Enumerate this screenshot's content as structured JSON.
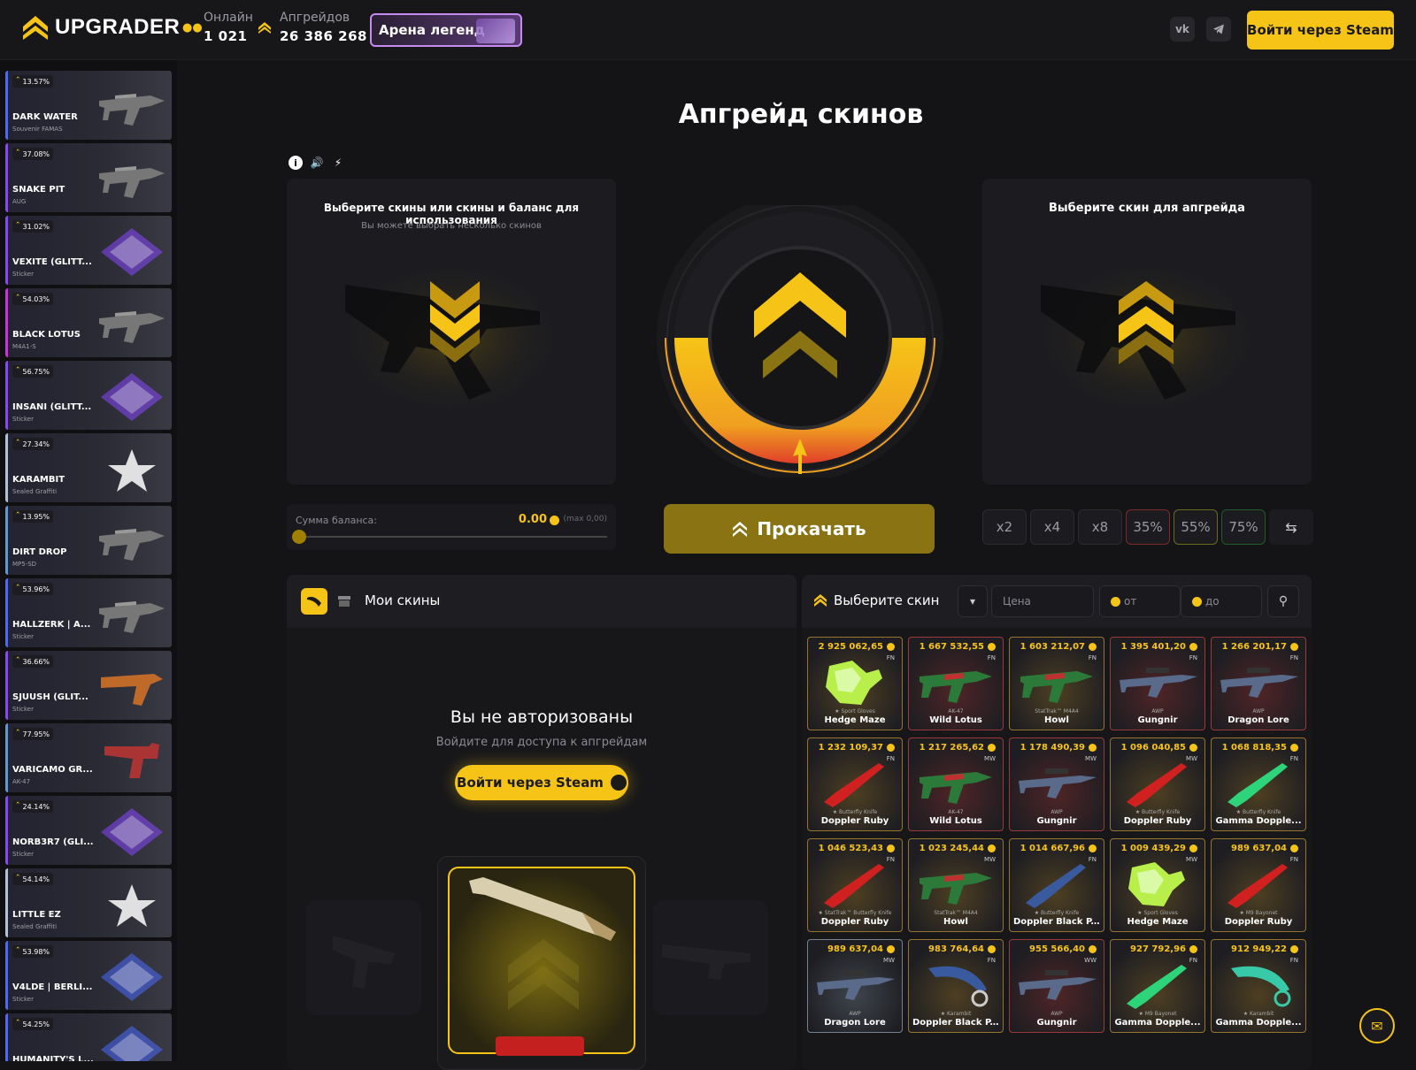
{
  "header": {
    "logo_text": "UPGRADER",
    "online_label": "Онлайн",
    "online_value": "1 021",
    "upgrades_label": "Апгрейдов",
    "upgrades_value": "26 386 268",
    "arena_label": "Арена легенд",
    "social": [
      "vk-icon",
      "telegram-icon"
    ],
    "login_label": "Войти через Steam"
  },
  "sidebar": {
    "items": [
      {
        "chance": "13.57%",
        "name": "DARK WATER",
        "sub": "Souvenir FAMAS",
        "accent": "#4b69ff",
        "img": "rifle"
      },
      {
        "chance": "37.08%",
        "name": "SNAKE PIT",
        "sub": "AUG",
        "accent": "#8847ff",
        "img": "rifle"
      },
      {
        "chance": "31.02%",
        "name": "VEXITE (GLITT...",
        "sub": "Sticker",
        "accent": "#8847ff",
        "img": "sticker"
      },
      {
        "chance": "54.03%",
        "name": "BLACK LOTUS",
        "sub": "M4A1-S",
        "accent": "#d32ce6",
        "img": "rifle"
      },
      {
        "chance": "56.75%",
        "name": "INSANI (GLITT...",
        "sub": "Sticker",
        "accent": "#8847ff",
        "img": "sticker"
      },
      {
        "chance": "27.34%",
        "name": "KARAMBIT",
        "sub": "Sealed Graffiti",
        "accent": "#b0c3d9",
        "img": "graffiti"
      },
      {
        "chance": "13.95%",
        "name": "DIRT DROP",
        "sub": "MP5-SD",
        "accent": "#5e98d9",
        "img": "rifle"
      },
      {
        "chance": "53.96%",
        "name": "HALLZERK | A...",
        "sub": "Sticker",
        "accent": "#4b69ff",
        "img": "rifle"
      },
      {
        "chance": "36.66%",
        "name": "SJUUSH (GLIT...",
        "sub": "Sticker",
        "accent": "#8847ff",
        "img": "smg"
      },
      {
        "chance": "77.95%",
        "name": "VARICAMO GR...",
        "sub": "AK-47",
        "accent": "#5e98d9",
        "img": "revolver"
      },
      {
        "chance": "24.14%",
        "name": "NORB3R7 (GLI...",
        "sub": "Sticker",
        "accent": "#8847ff",
        "img": "sticker"
      },
      {
        "chance": "54.14%",
        "name": "LITTLE EZ",
        "sub": "Sealed Graffiti",
        "accent": "#b0c3d9",
        "img": "graffiti"
      },
      {
        "chance": "53.98%",
        "name": "V4LDE | BERLI...",
        "sub": "Sticker",
        "accent": "#4b69ff",
        "img": "sticker"
      },
      {
        "chance": "54.25%",
        "name": "HUMANITY'S L...",
        "sub": "",
        "accent": "#4b69ff",
        "img": "sticker"
      }
    ]
  },
  "main": {
    "title": "Апгрейд скинов",
    "left_panel_title": "Выберите скины или скины и баланс для использования",
    "left_panel_sub": "Вы можете выбрать несколько скинов",
    "right_panel_title": "Выберите скин для апгрейда",
    "balance_label": "Сумма баланса:",
    "balance_value": "0.00",
    "balance_max": "(max 0,00)",
    "balance_fraction": 0,
    "upgrade_label": "Прокачать",
    "multipliers": [
      "x2",
      "x4",
      "x8",
      "35%",
      "55%",
      "75%"
    ],
    "mult_colors": [
      "#2a2a30",
      "#2a2a30",
      "#2a2a30",
      "#7a2a2a",
      "#6a6a1a",
      "#1f5a2a"
    ]
  },
  "my_skins": {
    "title": "Мои скины",
    "noauth_title": "Вы не авторизованы",
    "noauth_sub": "Войдите для доступа к апгрейдам",
    "login_label": "Войти через Steam"
  },
  "choose": {
    "title": "Выберите скин",
    "price_placeholder": "Цена",
    "from_placeholder": "от",
    "to_placeholder": "до",
    "cards": [
      {
        "price": "2 925 062,65",
        "q": "FN",
        "w": "★ Sport Gloves",
        "n": "Hedge Maze",
        "color": "#e4ae39",
        "img": "gloves"
      },
      {
        "price": "1 667 532,55",
        "q": "FN",
        "w": "AK-47",
        "n": "Wild Lotus",
        "color": "#eb4b4b",
        "img": "ak"
      },
      {
        "price": "1 603 212,07",
        "q": "FN",
        "w": "StatTrak™ M4A4",
        "n": "Howl",
        "color": "#e4ae39",
        "img": "ak"
      },
      {
        "price": "1 395 401,20",
        "q": "FN",
        "w": "AWP",
        "n": "Gungnir",
        "color": "#eb4b4b",
        "img": "awp"
      },
      {
        "price": "1 266 201,17",
        "q": "FN",
        "w": "AWP",
        "n": "Dragon Lore",
        "color": "#eb4b4b",
        "img": "awp"
      },
      {
        "price": "1 232 109,37",
        "q": "FN",
        "w": "★ Butterfly Knife",
        "n": "Doppler Ruby",
        "color": "#e4ae39",
        "img": "knife"
      },
      {
        "price": "1 217 265,62",
        "q": "MW",
        "w": "AK-47",
        "n": "Wild Lotus",
        "color": "#eb4b4b",
        "img": "ak"
      },
      {
        "price": "1 178 490,39",
        "q": "MW",
        "w": "AWP",
        "n": "Gungnir",
        "color": "#eb4b4b",
        "img": "awp"
      },
      {
        "price": "1 096 040,85",
        "q": "MW",
        "w": "★ Butterfly Knife",
        "n": "Doppler Ruby",
        "color": "#e4ae39",
        "img": "knife"
      },
      {
        "price": "1 068 818,35",
        "q": "FN",
        "w": "★ Butterfly Knife",
        "n": "Gamma Dopple...",
        "color": "#e4ae39",
        "img": "knife2"
      },
      {
        "price": "1 046 523,43",
        "q": "FN",
        "w": "★ StatTrak™ Butterfly Knife",
        "n": "Doppler Ruby",
        "color": "#e4ae39",
        "img": "knife"
      },
      {
        "price": "1 023 245,44",
        "q": "MW",
        "w": "StatTrak™ M4A4",
        "n": "Howl",
        "color": "#e4ae39",
        "img": "ak"
      },
      {
        "price": "1 014 667,96",
        "q": "FN",
        "w": "★ Butterfly Knife",
        "n": "Doppler Black P...",
        "color": "#e4ae39",
        "img": "knife3"
      },
      {
        "price": "1 009 439,29",
        "q": "MW",
        "w": "★ Sport Gloves",
        "n": "Hedge Maze",
        "color": "#e4ae39",
        "img": "gloves"
      },
      {
        "price": "989 637,04",
        "q": "FN",
        "w": "★ M9 Bayonet",
        "n": "Doppler Ruby",
        "color": "#e4ae39",
        "img": "knife"
      },
      {
        "price": "989 637,04",
        "q": "MW",
        "w": "AWP",
        "n": "Dragon Lore",
        "color": "#b0c3d9",
        "img": "awp"
      },
      {
        "price": "983 764,64",
        "q": "FN",
        "w": "★ Karambit",
        "n": "Doppler Black P...",
        "color": "#e4ae39",
        "img": "karambit"
      },
      {
        "price": "955 566,40",
        "q": "WW",
        "w": "AWP",
        "n": "Gungnir",
        "color": "#eb4b4b",
        "img": "awp"
      },
      {
        "price": "927 792,96",
        "q": "FN",
        "w": "★ M9 Bayonet",
        "n": "Gamma Dopple...",
        "color": "#e4ae39",
        "img": "knife2"
      },
      {
        "price": "912 949,22",
        "q": "FN",
        "w": "★ Karambit",
        "n": "Gamma Dopple...",
        "color": "#e4ae39",
        "img": "karambit2"
      }
    ]
  }
}
